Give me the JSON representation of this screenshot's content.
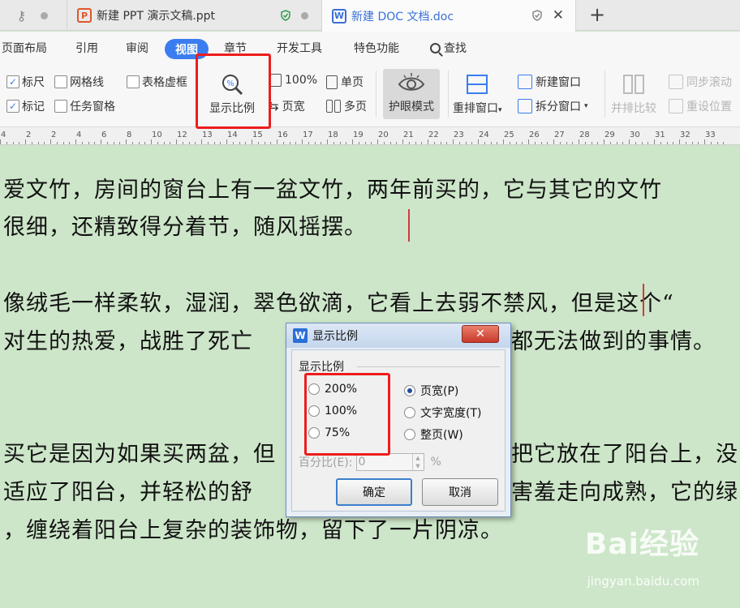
{
  "tabs": {
    "ppt_title": "新建 PPT 演示文稿.ppt",
    "doc_title": "新建 DOC 文档.doc",
    "new_tab": "+",
    "close": "✕"
  },
  "menu": {
    "items": [
      "页面布局",
      "引用",
      "审阅",
      "视图",
      "章节",
      "开发工具",
      "特色功能",
      "查找"
    ],
    "active": "视图"
  },
  "toolbar": {
    "ruler_label": "标尺",
    "gridlines_label": "网格线",
    "table_gridlines_label": "表格虚框",
    "bookmark_label": "标记",
    "task_pane_label": "任务窗格",
    "zoom_label": "显示比例",
    "hundred_label": "100%",
    "page_width_label": "页宽",
    "single_page_label": "单页",
    "multi_page_label": "多页",
    "eye_mode_label": "护眼模式",
    "rearrange_label": "重排窗口",
    "new_window_label": "新建窗口",
    "split_window_label": "拆分窗口",
    "side_by_side_label": "并排比较",
    "sync_scroll_label": "同步滚动",
    "reset_position_label": "重设位置"
  },
  "ruler": {
    "numbers": [
      "4",
      "2",
      "2",
      "4",
      "6",
      "8",
      "10",
      "12",
      "13",
      "14",
      "15",
      "16",
      "17",
      "18",
      "19",
      "20",
      "21",
      "22",
      "23",
      "24",
      "25",
      "26",
      "27",
      "28",
      "29",
      "30",
      "31",
      "32",
      "33"
    ]
  },
  "document": {
    "line1": "爱文竹，房间的窗台上有一盆文竹，两年前买的，它与其它的文竹",
    "line2": "很细，还精致得分着节，随风摇摆。",
    "line3": "像绒毛一样柔软，湿润，翠色欲滴，它看上去弱不禁风，但是这个“",
    "line4": "对生的热爱，战胜了死亡",
    "line4b": "都无法做到的事情。",
    "line5": "买它是因为如果买两盆，但",
    "line5b": "把它放在了阳台上，没",
    "line6": "适应了阳台，并轻松的舒",
    "line6b": "害羞走向成熟，它的绿",
    "line7": "，缠绕着阳台上复杂的装饰物，留下了一片阴凉。"
  },
  "dialog": {
    "title": "显示比例",
    "close": "✕",
    "group_label": "显示比例",
    "zoom_options": [
      "200%",
      "100%",
      "75%"
    ],
    "fit_options": [
      "页宽(P)",
      "文字宽度(T)",
      "整页(W)"
    ],
    "fit_selected": "页宽(P)",
    "percent_label": "百分比(E):",
    "percent_value": "0",
    "percent_unit": "%",
    "ok_label": "确定",
    "cancel_label": "取消"
  },
  "watermark": {
    "brand": "Bai经验",
    "url": "jingyan.baidu.com"
  }
}
